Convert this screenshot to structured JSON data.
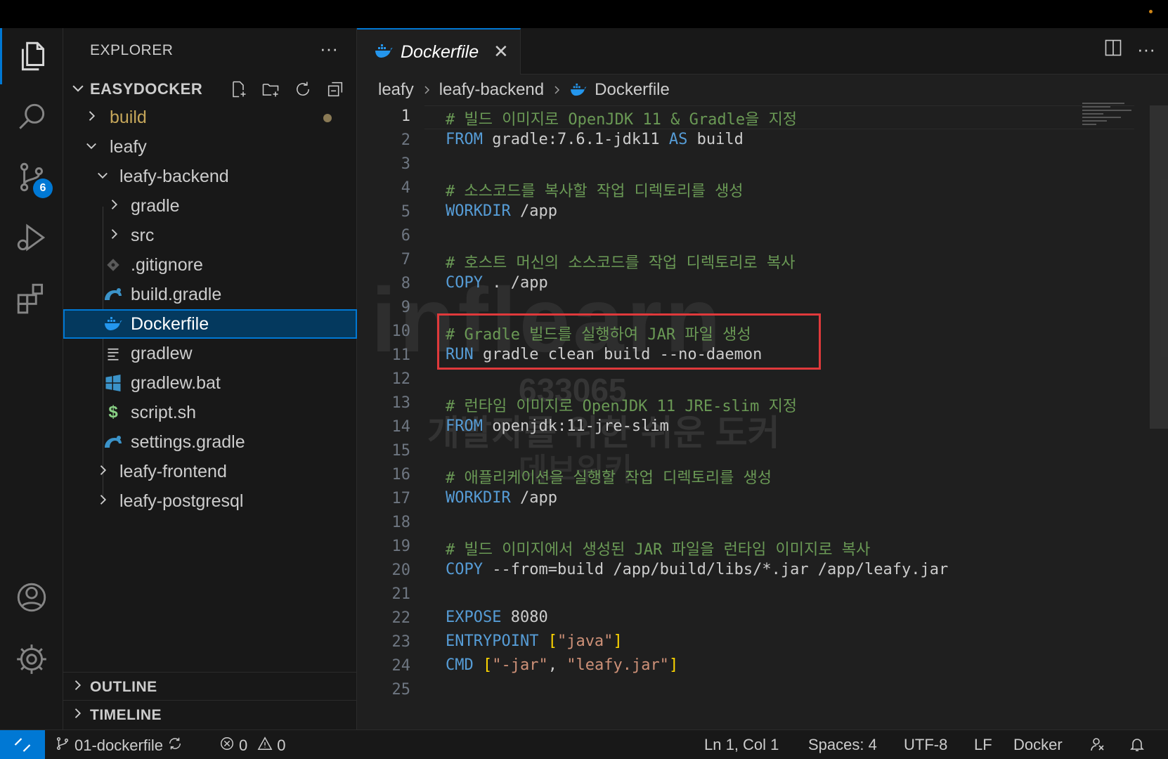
{
  "sidebar": {
    "title": "EXPLORER",
    "project": "EASYDOCKER",
    "tree": [
      {
        "label": "build",
        "type": "folder"
      },
      {
        "label": "leafy",
        "type": "folder"
      },
      {
        "label": "leafy-backend",
        "type": "folder"
      },
      {
        "label": "gradle",
        "type": "folder"
      },
      {
        "label": "src",
        "type": "folder"
      },
      {
        "label": ".gitignore",
        "type": "file"
      },
      {
        "label": "build.gradle",
        "type": "file"
      },
      {
        "label": "Dockerfile",
        "type": "file"
      },
      {
        "label": "gradlew",
        "type": "file"
      },
      {
        "label": "gradlew.bat",
        "type": "file"
      },
      {
        "label": "script.sh",
        "type": "file"
      },
      {
        "label": "settings.gradle",
        "type": "file"
      },
      {
        "label": "leafy-frontend",
        "type": "folder"
      },
      {
        "label": "leafy-postgresql",
        "type": "folder"
      }
    ],
    "outline": "OUTLINE",
    "timeline": "TIMELINE"
  },
  "activity": {
    "scm_badge": "6"
  },
  "tab": {
    "label": "Dockerfile"
  },
  "breadcrumb": [
    "leafy",
    "leafy-backend",
    "Dockerfile"
  ],
  "editor": {
    "lines": [
      {
        "n": "1",
        "text": "# 빌드 이미지로 OpenJDK 11 & Gradle을 지정"
      },
      {
        "n": "2",
        "kw": "FROM",
        "text": " gradle:7.6.1-jdk11 ",
        "kw2": "AS",
        "text2": " build"
      },
      {
        "n": "3"
      },
      {
        "n": "4",
        "text": "# 소스코드를 복사할 작업 디렉토리를 생성"
      },
      {
        "n": "5",
        "kw": "WORKDIR",
        "text": " /app"
      },
      {
        "n": "6"
      },
      {
        "n": "7",
        "text": "# 호스트 머신의 소스코드를 작업 디렉토리로 복사"
      },
      {
        "n": "8",
        "kw": "COPY",
        "text": " . /app"
      },
      {
        "n": "9"
      },
      {
        "n": "10",
        "text": "# Gradle 빌드를 실행하여 JAR 파일 생성"
      },
      {
        "n": "11",
        "kw": "RUN",
        "text": " gradle clean build --no-daemon"
      },
      {
        "n": "12"
      },
      {
        "n": "13",
        "text": "# 런타임 이미지로 OpenJDK 11 JRE-slim 지정"
      },
      {
        "n": "14",
        "kw": "FROM",
        "text": " openjdk:11-jre-slim"
      },
      {
        "n": "15"
      },
      {
        "n": "16",
        "text": "# 애플리케이션을 실행할 작업 디렉토리를 생성"
      },
      {
        "n": "17",
        "kw": "WORKDIR",
        "text": " /app"
      },
      {
        "n": "18"
      },
      {
        "n": "19",
        "text": "# 빌드 이미지에서 생성된 JAR 파일을 런타임 이미지로 복사"
      },
      {
        "n": "20",
        "kw": "COPY",
        "text": " --from=build /app/build/libs/*.jar /app/leafy.jar"
      },
      {
        "n": "21"
      },
      {
        "n": "22",
        "kw": "EXPOSE",
        "text": " 8080"
      },
      {
        "n": "23",
        "kw": "ENTRYPOINT",
        "b1": " [",
        "str1": "\"java\"",
        "b2": "]"
      },
      {
        "n": "24",
        "kw": "CMD",
        "b1": " [",
        "str1": "\"-jar\"",
        "mid": ", ",
        "str2": "\"leafy.jar\"",
        "b2": "]"
      },
      {
        "n": "25"
      }
    ]
  },
  "watermark": {
    "logo": "inflearn",
    "id": "633065",
    "line1": "개발자를 위한 쉬운 도커",
    "line2": "데브위키"
  },
  "statusbar": {
    "branch": "01-dockerfile",
    "errors": "0",
    "warnings": "0",
    "position": "Ln 1, Col 1",
    "spaces": "Spaces: 4",
    "encoding": "UTF-8",
    "eol": "LF",
    "language": "Docker"
  },
  "colors": {
    "accent": "#0078d4",
    "highlight_box": "#e0393b",
    "comment": "#6a9955",
    "keyword": "#569cd6",
    "string": "#ce9178"
  }
}
